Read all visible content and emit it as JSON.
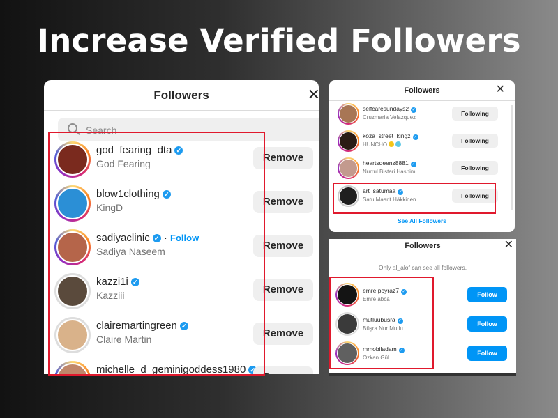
{
  "headline": "Increase Verified Followers",
  "colors": {
    "accent": "#0095f6",
    "verified": "#1d9bf0",
    "highlight": "#e0192d"
  },
  "panel_main": {
    "title": "Followers",
    "close_icon": "close-icon",
    "search_placeholder": "Search",
    "action_label": "Remove",
    "follow_link": "Follow",
    "rows": [
      {
        "username": "god_fearing_dta",
        "fullname": "God Fearing",
        "avatar_color": "#7a2a1e"
      },
      {
        "username": "blow1clothing",
        "fullname": "KingD",
        "avatar_color": "#2b8fd6"
      },
      {
        "username": "sadiyaclinic",
        "fullname": "Sadiya Naseem",
        "avatar_color": "#b5654a"
      },
      {
        "username": "kazzi1i",
        "fullname": "Kazziii",
        "avatar_color": "#5a4a3c"
      },
      {
        "username": "clairemartingreen",
        "fullname": "Claire Martin",
        "avatar_color": "#d9b28a"
      },
      {
        "username": "michelle_d_geminigoddess1980",
        "fullname": "",
        "avatar_color": "#c0876a"
      }
    ]
  },
  "panel_following": {
    "title": "Followers",
    "action_label": "Following",
    "see_all": "See All Followers",
    "rows": [
      {
        "username": "selfcaresundays2",
        "fullname": "Cruzmaria Velazquez",
        "avatar_color": "#a87655"
      },
      {
        "username": "koza_street_kingz",
        "fullname": "HUNCHO",
        "avatar_color": "#2a1c14"
      },
      {
        "username": "heartsdeenz8881",
        "fullname": "Nurrul Bistari Hashim",
        "avatar_color": "#c39a8e"
      },
      {
        "username": "art_satumaa",
        "fullname": "Satu Maarit Häkkinen",
        "avatar_color": "#1f1f1f"
      }
    ]
  },
  "panel_follow": {
    "title": "Followers",
    "note": "Only al_alof can see all followers.",
    "action_label": "Follow",
    "rows": [
      {
        "username": "emre.poyraz7",
        "fullname": "Emre abca",
        "avatar_color": "#141414"
      },
      {
        "username": "mutluubusra",
        "fullname": "Büşra Nur Mutlu",
        "avatar_color": "#3a3a3a"
      },
      {
        "username": "mmobiladam",
        "fullname": "Özkan Gül",
        "avatar_color": "#606060"
      }
    ]
  }
}
